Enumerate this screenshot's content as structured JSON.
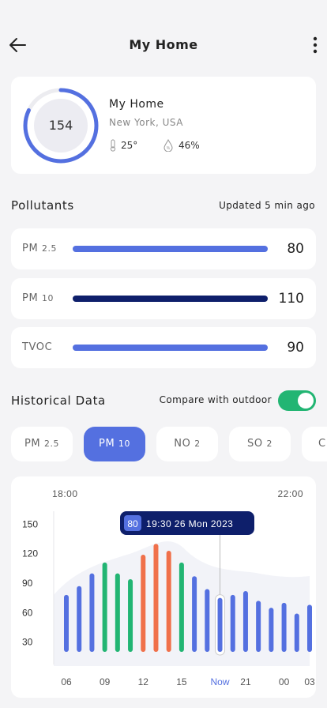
{
  "header": {
    "title": "My Home"
  },
  "home": {
    "aqi": "154",
    "aqi_fraction": 0.82,
    "name": "My Home",
    "location": "New York, USA",
    "temperature": "25°",
    "humidity": "46%"
  },
  "pollutants": {
    "title": "Pollutants",
    "updated": "Updated 5 min ago",
    "items": [
      {
        "label": "PM",
        "sub": "2.5",
        "value": "80",
        "color": "#5470e0"
      },
      {
        "label": "PM",
        "sub": "10",
        "value": "110",
        "color": "#0e1f6b"
      },
      {
        "label": "TVOC",
        "sub": "",
        "value": "90",
        "color": "#5470e0"
      }
    ]
  },
  "history": {
    "title": "Historical Data",
    "compare_label": "Compare with outdoor",
    "compare_on": true,
    "tabs": [
      {
        "label": "PM",
        "sub": "2.5",
        "active": false
      },
      {
        "label": "PM",
        "sub": "10",
        "active": true
      },
      {
        "label": "NO",
        "sub": "2",
        "active": false
      },
      {
        "label": "SO",
        "sub": "2",
        "active": false
      },
      {
        "label": "C",
        "sub": "",
        "active": false
      }
    ]
  },
  "colors": {
    "blue": "#5470e0",
    "green": "#22b573",
    "orange": "#f0704a",
    "navy": "#0e1f6b"
  },
  "chart_data": {
    "type": "bar",
    "top_labels": [
      "18:00",
      "22:00"
    ],
    "y_ticks": [
      "150",
      "120",
      "90",
      "60",
      "30"
    ],
    "ylim": [
      20,
      160
    ],
    "x_ticks": [
      "06",
      "09",
      "12",
      "15",
      "Now",
      "21",
      "00",
      "03"
    ],
    "tooltip": {
      "value": "80",
      "text": "19:30 26 Mon 2023"
    },
    "highlight_index": 12,
    "values": [
      78,
      87,
      100,
      111,
      100,
      94,
      119,
      130,
      123,
      111,
      97,
      84,
      75,
      78,
      82,
      72,
      65,
      70,
      59,
      68
    ],
    "colors": [
      "blue",
      "blue",
      "blue",
      "green",
      "green",
      "green",
      "orange",
      "orange",
      "orange",
      "green",
      "blue",
      "blue",
      "blue",
      "blue",
      "blue",
      "blue",
      "blue",
      "blue",
      "blue",
      "blue"
    ]
  }
}
